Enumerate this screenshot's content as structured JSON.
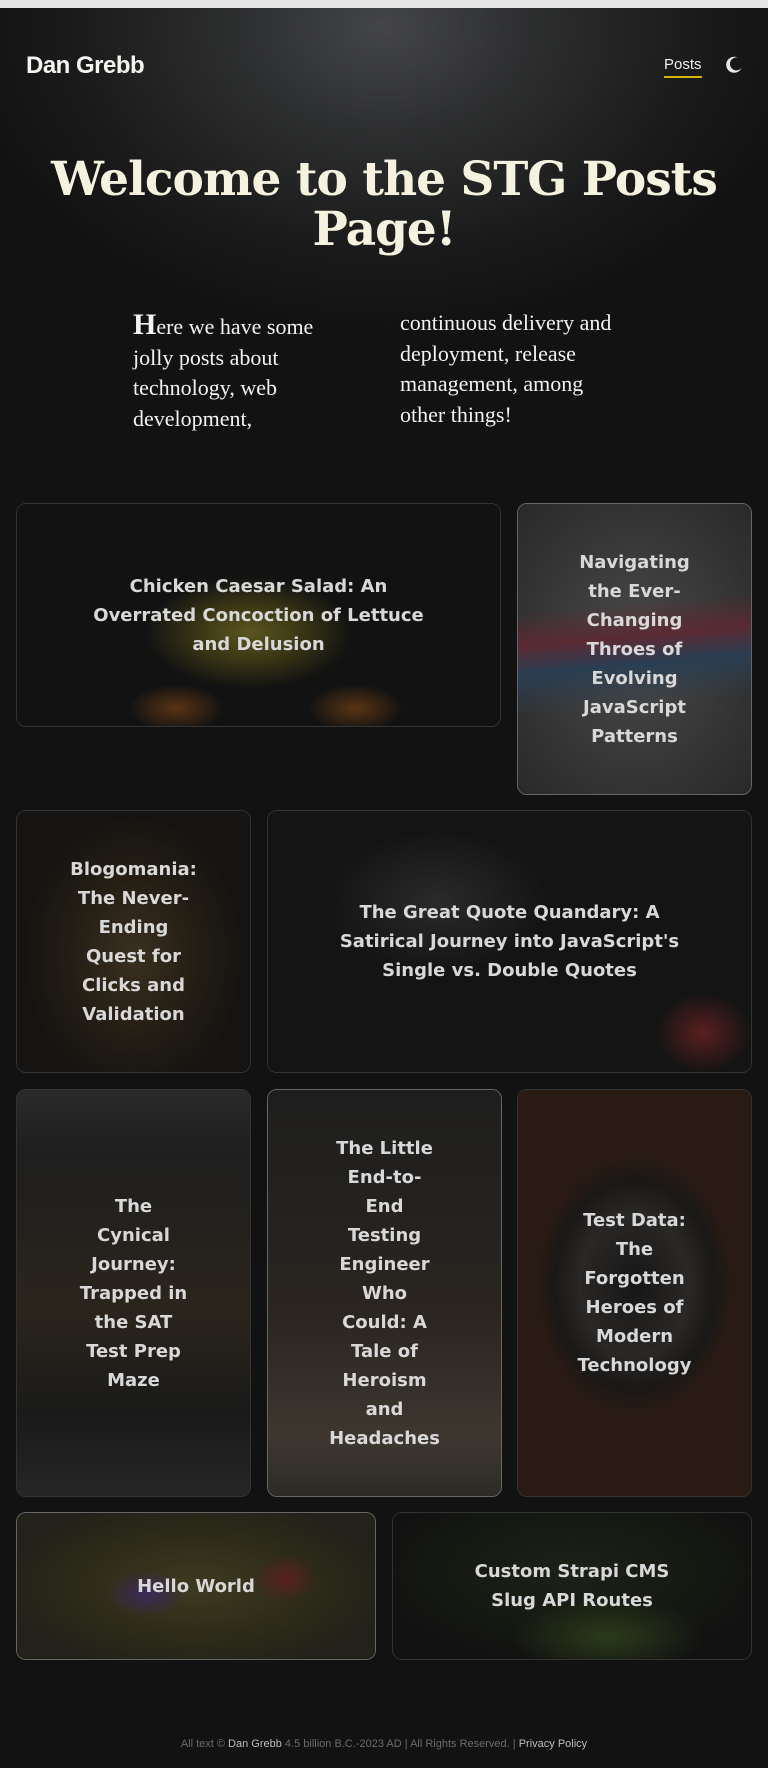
{
  "header": {
    "brand": "Dan Grebb",
    "nav": [
      {
        "label": "Posts"
      }
    ],
    "theme_icon": "moon-icon"
  },
  "hero": {
    "title": "Welcome to the STG Posts Page!",
    "intro_dropcap": "H",
    "intro_col1": "ere we have some jolly posts about technology, web development,",
    "intro_col2": "continuous delivery and deployment, release management, among other things!"
  },
  "posts": [
    {
      "title": "Chicken Caesar Salad: An Overrated Concoction of Lettuce and Delusion"
    },
    {
      "title": "Navigating the Ever-Changing Throes of Evolving JavaScript Patterns"
    },
    {
      "title": "Blogomania: The Never-Ending Quest for Clicks and Validation"
    },
    {
      "title": "The Great Quote Quandary: A Satirical Journey into JavaScript's Single vs. Double Quotes"
    },
    {
      "title": "The Cynical Journey: Trapped in the SAT Test Prep Maze"
    },
    {
      "title": "The Little End-to-End Testing Engineer Who Could: A Tale of Heroism and Headaches"
    },
    {
      "title": "Test Data: The Forgotten Heroes of Modern Technology"
    },
    {
      "title": "Hello World"
    },
    {
      "title": "Custom Strapi CMS Slug API Routes"
    }
  ],
  "footer": {
    "prefix": "All text ©",
    "author": "Dan Grebb",
    "middle": "4.5 billion B.C.-2023 AD | All Rights Reserved. |",
    "privacy": "Privacy Policy"
  }
}
